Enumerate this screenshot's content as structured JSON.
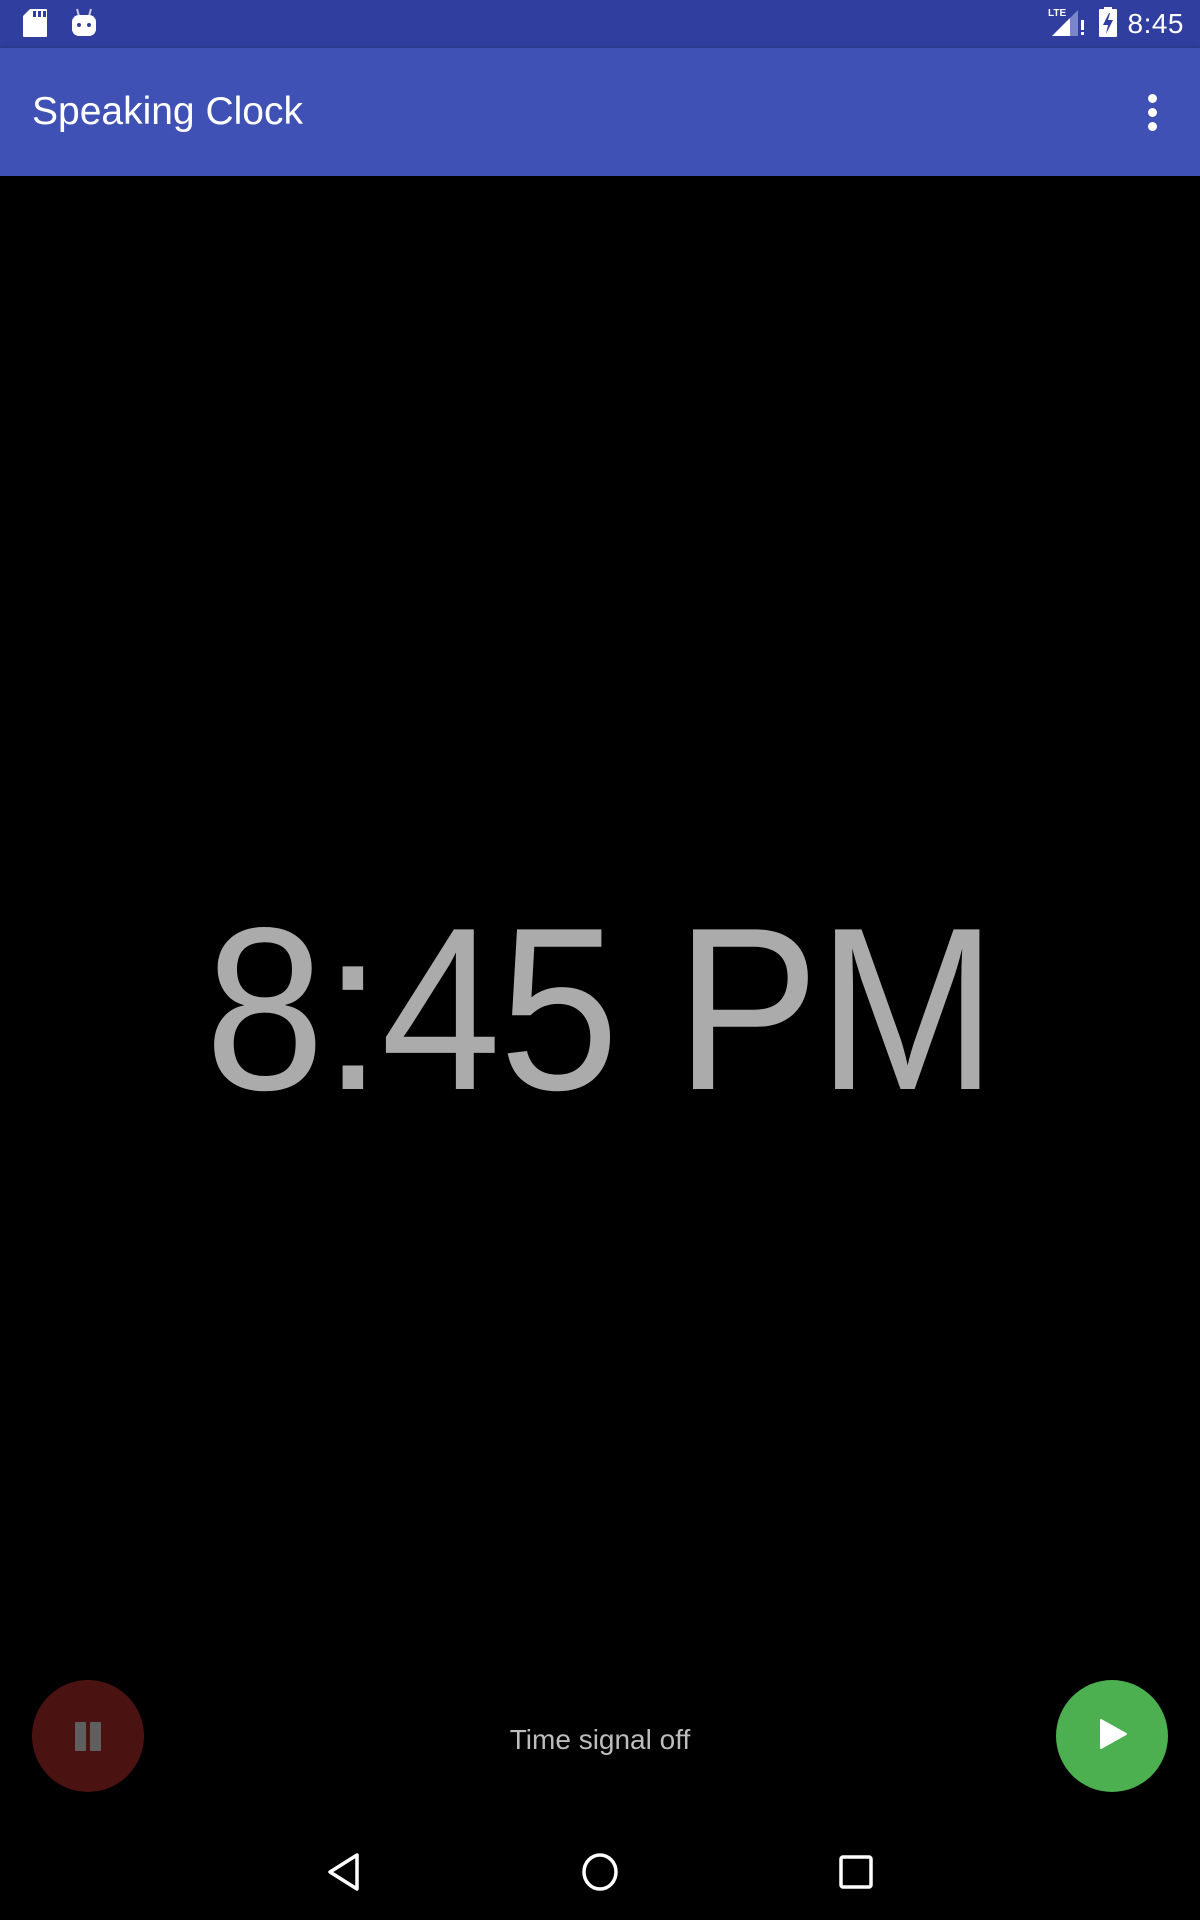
{
  "status_bar": {
    "left_icons": [
      "sd-card-icon",
      "android-icon"
    ],
    "network_label": "LTE",
    "right_icons": [
      "signal-icon",
      "battery-charging-icon"
    ],
    "time": "8:45"
  },
  "app_bar": {
    "title": "Speaking Clock",
    "overflow_icon": "more-vert-icon"
  },
  "clock": {
    "time": "8:45 PM"
  },
  "controls": {
    "pause_icon": "pause-icon",
    "play_icon": "play-icon",
    "signal_status": "Time signal off"
  },
  "colors": {
    "status_bar": "#303f9f",
    "app_bar": "#3f51b5",
    "play_fab": "#4caf50",
    "pause_fab": "#4a1210",
    "clock_text": "#ababab"
  },
  "nav_bar": {
    "buttons": [
      "back",
      "home",
      "recents"
    ]
  }
}
